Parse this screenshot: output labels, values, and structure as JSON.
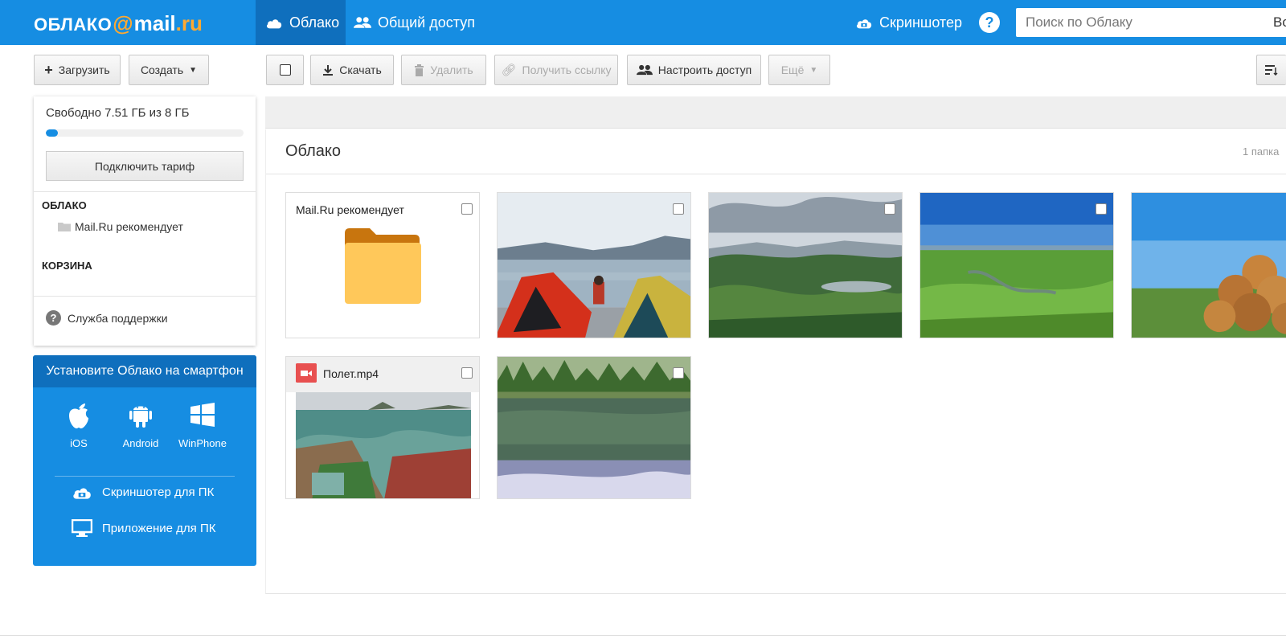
{
  "header": {
    "logo": {
      "part1": "ОБЛАКО",
      "at": "@",
      "part2": "mail",
      "part3": ".ru"
    },
    "tabs": [
      {
        "label": "Облако",
        "active": true,
        "icon": "cloud-icon"
      },
      {
        "label": "Общий доступ",
        "active": false,
        "icon": "users-icon"
      }
    ],
    "screenshoter_label": "Скриншотер",
    "help_label": "?",
    "search": {
      "placeholder": "Поиск по Облаку",
      "tail": "Вс"
    }
  },
  "toolbar_left": {
    "upload_label": "Загрузить",
    "create_label": "Создать"
  },
  "toolbar_main": {
    "download_label": "Скачать",
    "delete_label": "Удалить",
    "get_link_label": "Получить ссылку",
    "access_label": "Настроить доступ",
    "more_label": "Ещё"
  },
  "sidebar": {
    "quota": {
      "text": "Свободно 7.51 ГБ из 8 ГБ",
      "used_fraction": 0.061
    },
    "tariff_label": "Подключить тариф",
    "cloud_section": "ОБЛАКО",
    "folder_item": "Mail.Ru рекомендует",
    "trash_section": "КОРЗИНА",
    "support_label": "Служба поддержки",
    "support_icon": "?"
  },
  "apps_panel": {
    "title": "Установите Облако на смартфон",
    "platforms": [
      {
        "label": "iOS",
        "icon": "apple-icon"
      },
      {
        "label": "Android",
        "icon": "android-icon"
      },
      {
        "label": "WinPhone",
        "icon": "windows-icon"
      }
    ],
    "screenshoter_pc": "Скриншотер для ПК",
    "pc_app": "Приложение для ПК"
  },
  "content": {
    "title": "Облако",
    "count": "1 папка",
    "items": [
      {
        "type": "folder",
        "name": "Mail.Ru рекомендует"
      },
      {
        "type": "image",
        "subject": "tents-by-lake"
      },
      {
        "type": "image",
        "subject": "mountain-valley-lake"
      },
      {
        "type": "image",
        "subject": "green-plain-river"
      },
      {
        "type": "image",
        "subject": "hay-bales"
      },
      {
        "type": "video",
        "name": "Полет.mp4"
      },
      {
        "type": "image",
        "subject": "forest-lake-reflection"
      }
    ]
  },
  "colors": {
    "brand_blue": "#168de2",
    "dark_blue": "#0f6fbd",
    "logo_orange": "#ffa930",
    "folder_yellow": "#ffc85a"
  }
}
